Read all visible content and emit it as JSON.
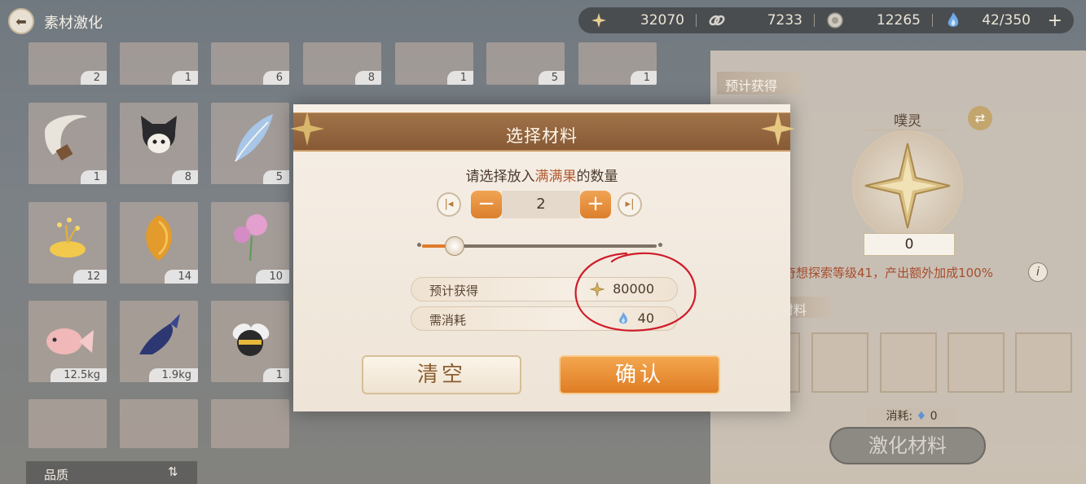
{
  "header": {
    "title": "素材激化",
    "resources": [
      {
        "icon": "sparkle-star-icon",
        "value": "32070"
      },
      {
        "icon": "chain-link-icon",
        "value": "7233"
      },
      {
        "icon": "coin-icon",
        "value": "12265"
      },
      {
        "icon": "blue-flame-icon",
        "value": "42/350"
      }
    ],
    "plus_label": "+"
  },
  "materials": {
    "items": [
      {
        "count": "2"
      },
      {
        "count": "1"
      },
      {
        "count": "6"
      },
      {
        "count": "8"
      },
      {
        "count": "1"
      },
      {
        "count": "5"
      },
      {
        "count": "1"
      },
      {
        "count": "1"
      },
      {
        "count": "8"
      },
      {
        "count": "5"
      },
      {
        "count": "12"
      },
      {
        "count": "14"
      },
      {
        "count": "10"
      },
      {
        "count": "12.5kg"
      },
      {
        "count": "1.9kg"
      },
      {
        "count": "1"
      }
    ],
    "quality_label": "品质",
    "quality_toggle": "⇅"
  },
  "right_panel": {
    "expected_label": "预计获得",
    "spirit_name": "噗灵",
    "swap_icon": "⇄",
    "emblem_value": "0",
    "bonus_text": "奇想探索等级41，产出额外加成100%",
    "info_icon": "i",
    "material_label": "材料",
    "consume_label": "消耗:",
    "consume_value": "0",
    "activate_label": "激化材料"
  },
  "dialog": {
    "title": "选择材料",
    "prompt_prefix": "请选择放入",
    "prompt_item": "满满果",
    "prompt_suffix": "的数量",
    "quantity": "2",
    "min_icon": "|◂",
    "max_icon": "▸|",
    "minus": "−",
    "plus": "+",
    "slider_fraction": 0.14,
    "expected_label": "预计获得",
    "expected_value": "80000",
    "cost_label": "需消耗",
    "cost_value": "40",
    "clear_label": "清空",
    "confirm_label": "确认"
  },
  "colors": {
    "accent_orange": "#e07b2d",
    "header_brown": "#875a36",
    "annotation_red": "#d01c2a"
  }
}
